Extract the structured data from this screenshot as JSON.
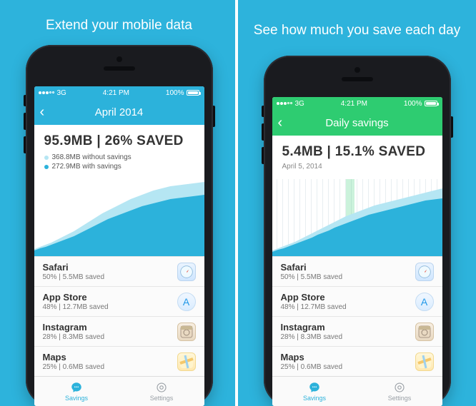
{
  "panels": [
    {
      "hero": "Extend your mobile data",
      "status": {
        "carrier": "3G",
        "time": "4:21 PM",
        "battery": "100%"
      },
      "nav": {
        "title": "April 2014",
        "color": "blue"
      },
      "summary": {
        "headline": "95.9MB | 26% SAVED",
        "legend": [
          {
            "dot": "light",
            "text": "368.8MB without savings"
          },
          {
            "dot": "dark",
            "text": "272.9MB with savings"
          }
        ]
      },
      "apps": [
        {
          "name": "Safari",
          "detail": "50% | 5.5MB saved",
          "icon": "safari"
        },
        {
          "name": "App Store",
          "detail": "48% | 12.7MB saved",
          "icon": "appstore"
        },
        {
          "name": "Instagram",
          "detail": "28% | 8.3MB saved",
          "icon": "instagram"
        },
        {
          "name": "Maps",
          "detail": "25% | 0.6MB saved",
          "icon": "maps"
        }
      ],
      "tabs": {
        "savings": "Savings",
        "settings": "Settings",
        "active": "savings"
      }
    },
    {
      "hero": "See how much you save each day",
      "status": {
        "carrier": "3G",
        "time": "4:21 PM",
        "battery": "100%"
      },
      "nav": {
        "title": "Daily savings",
        "color": "green"
      },
      "summary": {
        "headline": "5.4MB | 15.1% SAVED",
        "subdate": "April 5, 2014"
      },
      "apps": [
        {
          "name": "Safari",
          "detail": "50% | 5.5MB saved",
          "icon": "safari"
        },
        {
          "name": "App Store",
          "detail": "48% | 12.7MB saved",
          "icon": "appstore"
        },
        {
          "name": "Instagram",
          "detail": "28% | 8.3MB saved",
          "icon": "instagram"
        },
        {
          "name": "Maps",
          "detail": "25% | 0.6MB saved",
          "icon": "maps"
        }
      ],
      "tabs": {
        "savings": "Savings",
        "settings": "Settings",
        "active": "savings"
      }
    }
  ],
  "chart_data": [
    {
      "type": "area",
      "x_days": 30,
      "series": [
        {
          "name": "without savings",
          "color": "#b5e6f3",
          "values": [
            5,
            8,
            12,
            16,
            22,
            28,
            34,
            40,
            48,
            56,
            64,
            72,
            80,
            90,
            100,
            112,
            124,
            138,
            152,
            166,
            182,
            200,
            218,
            238,
            258,
            280,
            304,
            328,
            348,
            368
          ]
        },
        {
          "name": "with savings",
          "color": "#2cb2db",
          "values": [
            4,
            6,
            9,
            12,
            16,
            21,
            26,
            30,
            36,
            42,
            48,
            54,
            60,
            68,
            76,
            84,
            92,
            102,
            112,
            124,
            136,
            148,
            162,
            176,
            190,
            206,
            222,
            240,
            256,
            273
          ]
        }
      ],
      "ylim": [
        0,
        400
      ],
      "y_unit": "MB"
    },
    {
      "type": "area",
      "x_days": 30,
      "highlight_day": 14,
      "series": [
        {
          "name": "without savings",
          "color": "#b5e6f3",
          "values": [
            1,
            2,
            3,
            4,
            5,
            6.2,
            7.4,
            8.6,
            10,
            11.4,
            12.8,
            14.2,
            15.6,
            17,
            18.4,
            19.8,
            21.2,
            22.8,
            24.4,
            26,
            27.6,
            29.2,
            30.8,
            32.6,
            34.4,
            36.2,
            38,
            40,
            42,
            44
          ]
        },
        {
          "name": "with savings",
          "color": "#2cb2db",
          "values": [
            0.8,
            1.6,
            2.5,
            3.4,
            4.2,
            5.2,
            6.2,
            7.2,
            8.4,
            9.6,
            10.8,
            12,
            13.2,
            14.4,
            15.6,
            16.8,
            18,
            19.4,
            20.8,
            22.2,
            23.6,
            25,
            26.4,
            27.8,
            29.4,
            31,
            32.6,
            34.2,
            35.8,
            37.4
          ]
        }
      ],
      "ylim": [
        0,
        50
      ],
      "y_unit": "MB"
    }
  ]
}
